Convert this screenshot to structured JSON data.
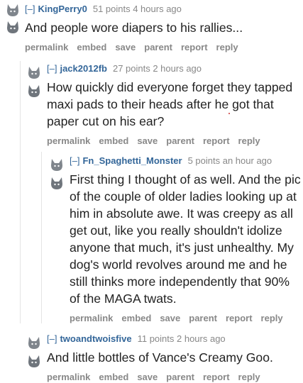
{
  "comments": [
    {
      "toggle": "[–]",
      "author": "KingPerry0",
      "meta": "51 points 4 hours ago",
      "body": "And people wore diapers to his rallies...",
      "actions": [
        "permalink",
        "embed",
        "save",
        "parent",
        "report",
        "reply"
      ]
    },
    {
      "toggle": "[–]",
      "author": "jack2012fb",
      "meta": "27 points 2 hours ago",
      "body": "How quickly did everyone forget they tapped maxi pads to their heads after he got that paper cut on his ear?",
      "actions": [
        "permalink",
        "embed",
        "save",
        "parent",
        "report",
        "reply"
      ]
    },
    {
      "toggle": "[–]",
      "author": "Fn_Spaghetti_Monster",
      "meta": "5 points an hour ago",
      "body": "First thing I thought of as well. And the pic of the couple of older ladies looking up at him in absolute awe. It was creepy as all get out, like you really shouldn't idolize anyone that much, it's just unhealthy. My dog's world revolves around me and he still thinks more independently that 90% of the MAGA twats.",
      "actions": [
        "permalink",
        "embed",
        "save",
        "parent",
        "report",
        "reply"
      ]
    },
    {
      "toggle": "[–]",
      "author": "twoandtwoisfive",
      "meta": "11 points 2 hours ago",
      "body": "And little bottles of Vance's Creamy Goo.",
      "actions": [
        "permalink",
        "embed",
        "save",
        "parent",
        "report",
        "reply"
      ]
    }
  ],
  "colors": {
    "link": "#336699",
    "meta": "#888888",
    "text": "#222222",
    "avatar": "#7f858c"
  },
  "icons": {
    "avatar": "cat-avatar-icon"
  }
}
